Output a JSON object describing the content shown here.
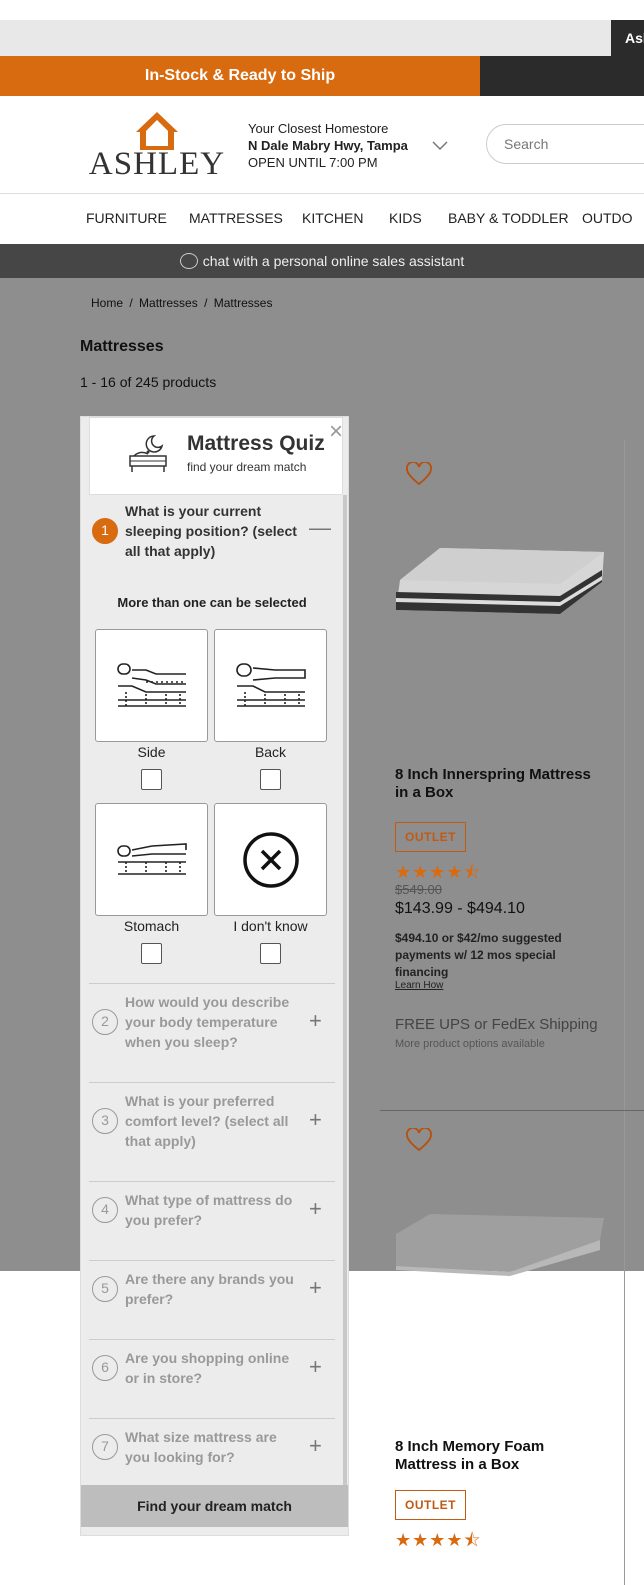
{
  "header": {
    "account_label": "Ash",
    "promo_text": "In-Stock & Ready to Ship",
    "logo_text": "ASHLEY",
    "store": {
      "line1": "Your Closest Homestore",
      "line2": "N Dale Mabry Hwy, Tampa",
      "line3": "OPEN UNTIL 7:00 PM"
    },
    "search_placeholder": "Search"
  },
  "nav": {
    "items": [
      "FURNITURE",
      "MATTRESSES",
      "KITCHEN",
      "KIDS",
      "BABY & TODDLER",
      "OUTDO"
    ]
  },
  "chat": {
    "label": "chat with a personal online sales assistant"
  },
  "breadcrumb": [
    "Home",
    "/",
    "Mattresses",
    "/",
    "Mattresses"
  ],
  "page": {
    "title": "Mattresses",
    "count": "1 - 16 of 245 products"
  },
  "quiz": {
    "title": "Mattress Quiz",
    "subtitle": "find your dream match",
    "close": "×",
    "multi_note": "More than one can be selected",
    "questions": [
      {
        "num": "1",
        "text": "What is your current sleeping position? (select all that apply)",
        "toggle": "—"
      },
      {
        "num": "2",
        "text": "How would you describe your body temperature when you sleep?",
        "toggle": "+"
      },
      {
        "num": "3",
        "text": "What is your preferred comfort level? (select all that apply)",
        "toggle": "+"
      },
      {
        "num": "4",
        "text": "What type of mattress do you prefer?",
        "toggle": "+"
      },
      {
        "num": "5",
        "text": "Are there any brands you prefer?",
        "toggle": "+"
      },
      {
        "num": "6",
        "text": "Are you shopping online or in store?",
        "toggle": "+"
      },
      {
        "num": "7",
        "text": "What size mattress are you looking for?",
        "toggle": "+"
      }
    ],
    "options": [
      {
        "label": "Side",
        "icon": "side-sleeper-icon",
        "checked": false
      },
      {
        "label": "Back",
        "icon": "back-sleeper-icon",
        "checked": false
      },
      {
        "label": "Stomach",
        "icon": "stomach-sleeper-icon",
        "checked": false
      },
      {
        "label": "I don't know",
        "icon": "x-circle-icon",
        "checked": false
      }
    ],
    "cta": "Find your dream match"
  },
  "products": [
    {
      "name_line1": "8 Inch Innerspring Mattress",
      "name_line2": "in a Box",
      "badge": "OUTLET",
      "rating": 4.5,
      "stars": "★★★★⯪",
      "was_price": "$549.00",
      "price": "$143.99 - $494.10",
      "financing": "$494.10 or $42/mo suggested payments w/ 12 mos special financing",
      "learn_how": "Learn How",
      "shipping": "FREE UPS or FedEx Shipping",
      "more_options": "More product options available"
    },
    {
      "name_line1": "8 Inch Memory Foam",
      "name_line2": "Mattress in a Box",
      "badge": "OUTLET",
      "rating": 4.5,
      "stars": "★★★★⯪"
    }
  ],
  "colors": {
    "brand_orange": "#d86a10",
    "overlay_grey": "#8e8e8e",
    "dark_bar": "#2b2b2b"
  }
}
